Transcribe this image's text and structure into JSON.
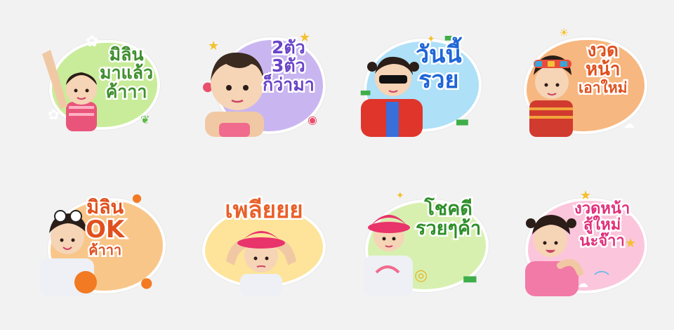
{
  "stickers": [
    {
      "lines": [
        "มิลิน",
        "มาแล้ว",
        "ค้าาา"
      ],
      "text_color": "#3f8f2e",
      "bg": "#c9ec9a"
    },
    {
      "lines": [
        "2ตัว",
        "3ตัว",
        "ก็ว่ามา"
      ],
      "text_color": "#6a45c7",
      "bg": "#c9b6f0"
    },
    {
      "lines": [
        "วันนี้",
        "รวย"
      ],
      "text_color": "#1f66d6",
      "bg": "#aee0f7"
    },
    {
      "lines": [
        "งวด",
        "หน้า",
        "เอาใหม่"
      ],
      "text_color": "#e0501e",
      "bg": "#f7b780"
    },
    {
      "lines": [
        "มิลิน",
        "OK",
        "ค้าาา"
      ],
      "text_color": "#e0501e",
      "bg": "#f9c68a"
    },
    {
      "lines": [
        "เพลียยย"
      ],
      "text_color": "#e9602a",
      "bg": "#fde49a"
    },
    {
      "lines": [
        "โชคดี",
        "รวยๆค้า"
      ],
      "text_color": "#2f8f2a",
      "bg": "#d7f0b0"
    },
    {
      "lines": [
        "งวดหน้า",
        "สู้ใหม่",
        "นะจ๊าา"
      ],
      "text_color": "#e0307a",
      "bg": "#fbc6dc"
    }
  ]
}
